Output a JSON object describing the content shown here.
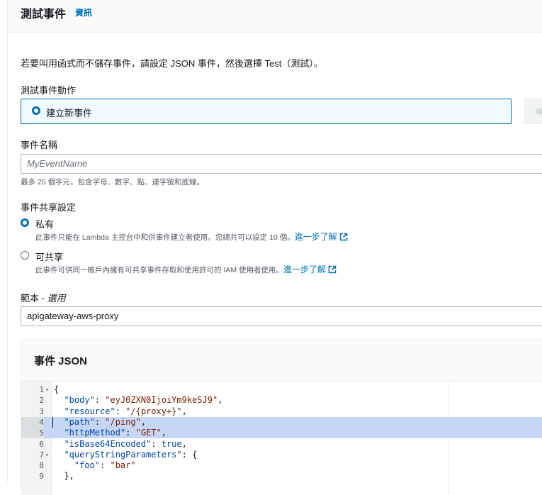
{
  "header": {
    "title": "測試事件",
    "info_link": "資訊"
  },
  "description": "若要叫用函式而不儲存事件，請設定 JSON 事件，然後選擇 Test（測試）。",
  "event_action": {
    "label": "測試事件動作",
    "selected_option": "建立新事件"
  },
  "event_name": {
    "label": "事件名稱",
    "placeholder": "MyEventName",
    "hint": "最多 25 個字元，包含字母、數字、點、連字號和底線。"
  },
  "sharing": {
    "label": "事件共享設定",
    "options": [
      {
        "label": "私有",
        "desc": "此事件只能在 Lambda 主控台中和供事件建立者使用。您總共可以設定 10 個。",
        "link": "進一步了解",
        "selected": true
      },
      {
        "label": "可共享",
        "desc": "此事件可供同一帳戶內擁有可共享事件存取和使用許可的 IAM 使用者使用。",
        "link": "進一步了解",
        "selected": false
      }
    ]
  },
  "template": {
    "label": "範本 - ",
    "label_optional": "選用",
    "value": "apigateway-aws-proxy"
  },
  "event_json": {
    "title": "事件 JSON",
    "lines": [
      {
        "n": "1",
        "fold": true,
        "text": "{"
      },
      {
        "n": "2",
        "fold": false,
        "text": "  \"body\": \"eyJ0ZXN0IjoiYm9keSJ9\","
      },
      {
        "n": "3",
        "fold": false,
        "text": "  \"resource\": \"/{proxy+}\","
      },
      {
        "n": "4",
        "fold": false,
        "text": "  \"path\": \"/ping\","
      },
      {
        "n": "5",
        "fold": false,
        "text": "  \"httpMethod\": \"GET\","
      },
      {
        "n": "6",
        "fold": false,
        "text": "  \"isBase64Encoded\": true,"
      },
      {
        "n": "7",
        "fold": true,
        "text": "  \"queryStringParameters\": {"
      },
      {
        "n": "8",
        "fold": false,
        "text": "    \"foo\": \"bar\""
      },
      {
        "n": "9",
        "fold": false,
        "text": "  },"
      }
    ],
    "highlighted_lines": [
      4,
      5
    ]
  }
}
